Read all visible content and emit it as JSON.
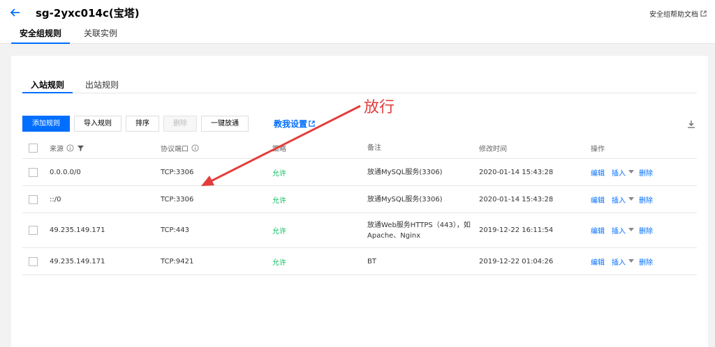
{
  "header": {
    "title": "sg-2yxc014c(宝塔)",
    "help_link": "安全组帮助文档",
    "tabs": [
      {
        "label": "安全组规则",
        "active": true
      },
      {
        "label": "关联实例",
        "active": false
      }
    ]
  },
  "rule_tabs": [
    {
      "label": "入站规则",
      "active": true
    },
    {
      "label": "出站规则",
      "active": false
    }
  ],
  "toolbar": {
    "add_rule": "添加规则",
    "import_rule": "导入规则",
    "sort": "排序",
    "delete": "删除",
    "allow_all": "一键放通",
    "teach_link": "教我设置"
  },
  "table": {
    "columns": {
      "source": "来源",
      "port": "协议端口",
      "policy": "策略",
      "note": "备注",
      "time": "修改时间",
      "ops": "操作"
    },
    "ops": {
      "edit": "编辑",
      "insert": "插入",
      "delete": "删除"
    },
    "rows": [
      {
        "source": "0.0.0.0/0",
        "port": "TCP:3306",
        "policy": "允许",
        "note": "放通MySQL服务(3306)",
        "time": "2020-01-14 15:43:28"
      },
      {
        "source": "::/0",
        "port": "TCP:3306",
        "policy": "允许",
        "note": "放通MySQL服务(3306)",
        "time": "2020-01-14 15:43:28"
      },
      {
        "source": "49.235.149.171",
        "port": "TCP:443",
        "policy": "允许",
        "note": "放通Web服务HTTPS（443），如Apache、Nginx",
        "time": "2019-12-22 16:11:54"
      },
      {
        "source": "49.235.149.171",
        "port": "TCP:9421",
        "policy": "允许",
        "note": "BT",
        "time": "2019-12-22 01:04:26"
      }
    ]
  },
  "annotation": {
    "text": "放行",
    "color": "#e43c3c"
  },
  "colors": {
    "accent": "#006eff",
    "allow": "#0abf5b"
  }
}
